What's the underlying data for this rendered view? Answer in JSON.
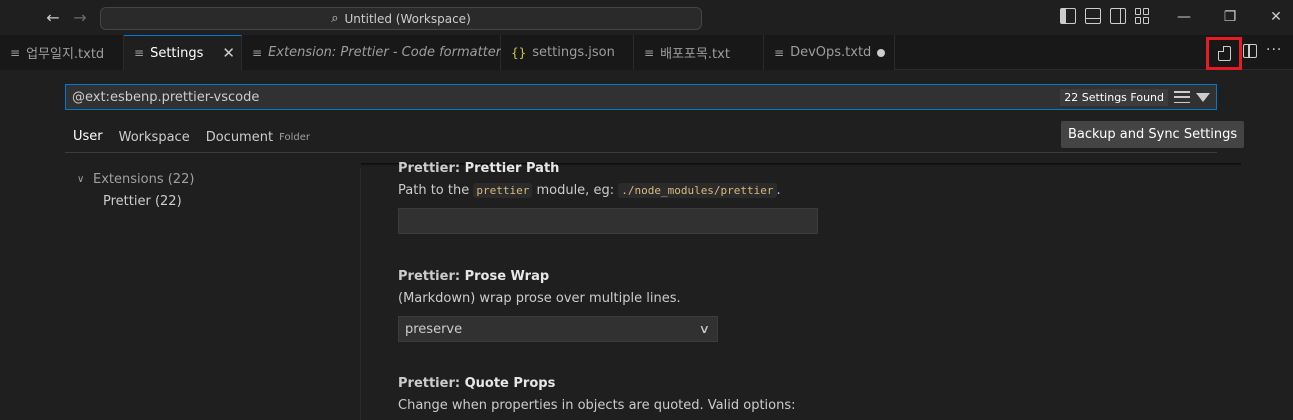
{
  "titlebar": {
    "title": "Untitled (Workspace)"
  },
  "tabs": [
    {
      "label": "업무일지.txtd",
      "icon": "lines-icon",
      "active": false
    },
    {
      "label": "Settings",
      "icon": "lines-icon",
      "active": true
    },
    {
      "label": "Extension: Prettier - Code formatter",
      "icon": "lines-icon",
      "active": false
    },
    {
      "label": "settings.json",
      "icon": "json-icon",
      "active": false
    },
    {
      "label": "배포포목.txt",
      "icon": "lines-icon",
      "active": false
    },
    {
      "label": "DevOps.txtd",
      "icon": "lines-icon",
      "active": false,
      "dirty": true
    }
  ],
  "search": {
    "value": "@ext:esbenp.prettier-vscode",
    "results": "22 Settings Found"
  },
  "scope_tabs": [
    {
      "label": "User",
      "active": true
    },
    {
      "label": "Workspace",
      "active": false
    },
    {
      "label": "Document",
      "suffix": "Folder",
      "active": false
    }
  ],
  "sync_button": "Backup and Sync Settings",
  "toc": {
    "group": "Extensions (22)",
    "child": "Prettier (22)"
  },
  "settings": [
    {
      "category": "Prettier: ",
      "key": "Prettier Path",
      "desc_before": "Path to the ",
      "code1": "prettier",
      "desc_middle": " module, eg: ",
      "code2": "./node_modules/prettier",
      "desc_after": "."
    },
    {
      "category": "Prettier: ",
      "key": "Prose Wrap",
      "desc": "(Markdown) wrap prose over multiple lines.",
      "value": "preserve"
    },
    {
      "category": "Prettier: ",
      "key": "Quote Props",
      "desc": "Change when properties in objects are quoted. Valid options:"
    }
  ],
  "colors": {
    "accent": "#0078d4",
    "highlight_box": "#e51c23"
  }
}
